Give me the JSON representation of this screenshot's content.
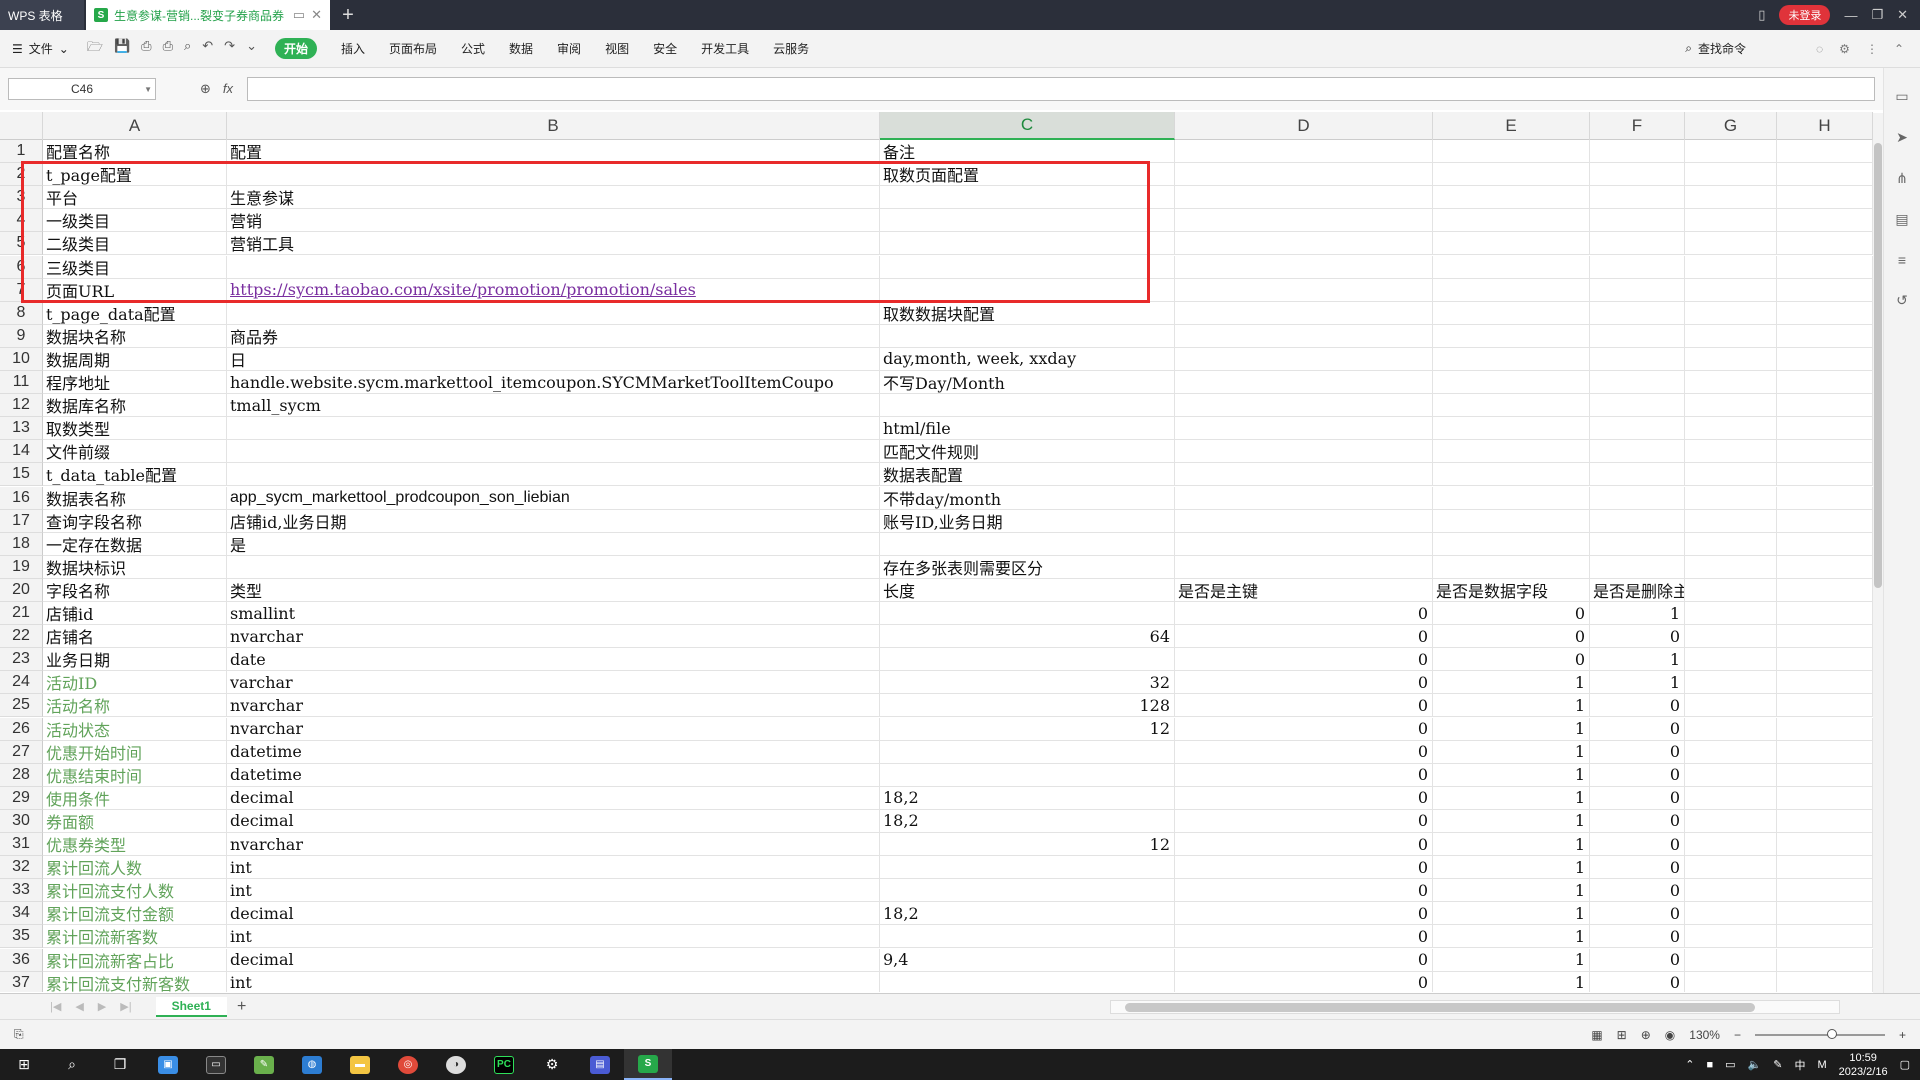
{
  "titlebar": {
    "app_tab": "WPS 表格",
    "doc_tab": "生意参谋-营销...裂变子券商品券",
    "login": "未登录"
  },
  "toolbar": {
    "file_label": "文件",
    "tabs": [
      "开始",
      "插入",
      "页面布局",
      "公式",
      "数据",
      "审阅",
      "视图",
      "安全",
      "开发工具",
      "云服务"
    ],
    "active_tab": "开始",
    "search_label": "查找命令"
  },
  "formula_bar": {
    "cell_ref": "C46",
    "fx_label": "fx",
    "formula": ""
  },
  "grid": {
    "columns": [
      "A",
      "B",
      "C",
      "D",
      "E",
      "F",
      "G",
      "H"
    ],
    "selected_column": "C",
    "rows": [
      {
        "n": "1",
        "a": "配置名称",
        "b": "配置",
        "c": "备注",
        "d": "",
        "e": "",
        "f": ""
      },
      {
        "n": "2",
        "a": "t_page配置",
        "b": "",
        "c": "取数页面配置",
        "d": "",
        "e": "",
        "f": ""
      },
      {
        "n": "3",
        "a": "平台",
        "b": "生意参谋",
        "c": "",
        "d": "",
        "e": "",
        "f": ""
      },
      {
        "n": "4",
        "a": "一级类目",
        "b": "营销",
        "c": "",
        "d": "",
        "e": "",
        "f": ""
      },
      {
        "n": "5",
        "a": "二级类目",
        "b": "营销工具",
        "c": "",
        "d": "",
        "e": "",
        "f": ""
      },
      {
        "n": "6",
        "a": "三级类目",
        "b": "",
        "c": "",
        "d": "",
        "e": "",
        "f": ""
      },
      {
        "n": "7",
        "a": "页面URL",
        "b": "https://sycm.taobao.com/xsite/promotion/promotion/sales",
        "c": "",
        "d": "",
        "e": "",
        "f": ""
      },
      {
        "n": "8",
        "a": "t_page_data配置",
        "b": "",
        "c": "取数数据块配置",
        "d": "",
        "e": "",
        "f": ""
      },
      {
        "n": "9",
        "a": "数据块名称",
        "b": "商品券",
        "c": "",
        "d": "",
        "e": "",
        "f": ""
      },
      {
        "n": "10",
        "a": "数据周期",
        "b": "日",
        "c": "day,month, week, xxday",
        "d": "",
        "e": "",
        "f": ""
      },
      {
        "n": "11",
        "a": "程序地址",
        "b": "handle.website.sycm.markettool_itemcoupon.SYCMMarketToolItemCoupo",
        "c": "不写Day/Month",
        "d": "",
        "e": "",
        "f": ""
      },
      {
        "n": "12",
        "a": "数据库名称",
        "b": "tmall_sycm",
        "c": "",
        "d": "",
        "e": "",
        "f": ""
      },
      {
        "n": "13",
        "a": "取数类型",
        "b": "",
        "c": "html/file",
        "d": "",
        "e": "",
        "f": ""
      },
      {
        "n": "14",
        "a": "文件前缀",
        "b": "",
        "c": "匹配文件规则",
        "d": "",
        "e": "",
        "f": ""
      },
      {
        "n": "15",
        "a": "t_data_table配置",
        "b": "",
        "c": "数据表配置",
        "d": "",
        "e": "",
        "f": ""
      },
      {
        "n": "16",
        "a": "数据表名称",
        "b": "app_sycm_markettool_prodcoupon_son_liebian",
        "c": "不带day/month",
        "d": "",
        "e": "",
        "f": ""
      },
      {
        "n": "17",
        "a": "查询字段名称",
        "b": "店铺id,业务日期",
        "c": "账号ID,业务日期",
        "d": "",
        "e": "",
        "f": ""
      },
      {
        "n": "18",
        "a": "一定存在数据",
        "b": "是",
        "c": "",
        "d": "",
        "e": "",
        "f": ""
      },
      {
        "n": "19",
        "a": "数据块标识",
        "b": "",
        "c": "存在多张表则需要区分",
        "d": "",
        "e": "",
        "f": ""
      },
      {
        "n": "20",
        "a": "字段名称",
        "b": "类型",
        "c": "长度",
        "d": "是否是主键",
        "e": "是否是数据字段",
        "f": "是否是删除主键"
      },
      {
        "n": "21",
        "a": "店铺id",
        "b": "smallint",
        "c": "",
        "d": "0",
        "e": "0",
        "f": "1"
      },
      {
        "n": "22",
        "a": "店铺名",
        "b": "nvarchar",
        "c": "64",
        "d": "0",
        "e": "0",
        "f": "0"
      },
      {
        "n": "23",
        "a": "业务日期",
        "b": "date",
        "c": "",
        "d": "0",
        "e": "0",
        "f": "1"
      },
      {
        "n": "24",
        "a": "活动ID",
        "b": "varchar",
        "c": "32",
        "d": "0",
        "e": "1",
        "f": "1"
      },
      {
        "n": "25",
        "a": "活动名称",
        "b": "nvarchar",
        "c": "128",
        "d": "0",
        "e": "1",
        "f": "0"
      },
      {
        "n": "26",
        "a": "活动状态",
        "b": "nvarchar",
        "c": "12",
        "d": "0",
        "e": "1",
        "f": "0"
      },
      {
        "n": "27",
        "a": "优惠开始时间",
        "b": "datetime",
        "c": "",
        "d": "0",
        "e": "1",
        "f": "0"
      },
      {
        "n": "28",
        "a": "优惠结束时间",
        "b": "datetime",
        "c": "",
        "d": "0",
        "e": "1",
        "f": "0"
      },
      {
        "n": "29",
        "a": "使用条件",
        "b": "decimal",
        "c": "18,2",
        "d": "0",
        "e": "1",
        "f": "0"
      },
      {
        "n": "30",
        "a": "券面额",
        "b": "decimal",
        "c": "18,2",
        "d": "0",
        "e": "1",
        "f": "0"
      },
      {
        "n": "31",
        "a": "优惠券类型",
        "b": "nvarchar",
        "c": "12",
        "d": "0",
        "e": "1",
        "f": "0"
      },
      {
        "n": "32",
        "a": "累计回流人数",
        "b": "int",
        "c": "",
        "d": "0",
        "e": "1",
        "f": "0"
      },
      {
        "n": "33",
        "a": "累计回流支付人数",
        "b": "int",
        "c": "",
        "d": "0",
        "e": "1",
        "f": "0"
      },
      {
        "n": "34",
        "a": "累计回流支付金额",
        "b": "decimal",
        "c": "18,2",
        "d": "0",
        "e": "1",
        "f": "0"
      },
      {
        "n": "35",
        "a": "累计回流新客数",
        "b": "int",
        "c": "",
        "d": "0",
        "e": "1",
        "f": "0"
      },
      {
        "n": "36",
        "a": "累计回流新客占比",
        "b": "decimal",
        "c": "9,4",
        "d": "0",
        "e": "1",
        "f": "0"
      },
      {
        "n": "37",
        "a": "累计回流支付新客数",
        "b": "int",
        "c": "",
        "d": "0",
        "e": "1",
        "f": "0"
      }
    ]
  },
  "sheets": {
    "tabs": [
      "Sheet1"
    ],
    "active": "Sheet1"
  },
  "statusbar": {
    "zoom": "130%"
  },
  "taskbar": {
    "time": "10:59",
    "date": "2023/2/16",
    "ime_lang": "中",
    "ime_mode": "M"
  },
  "colors": {
    "accent": "#2fb155",
    "highlight_border": "#e82a2a",
    "link": "#7a2fa0",
    "green_text": "#61a35a"
  }
}
